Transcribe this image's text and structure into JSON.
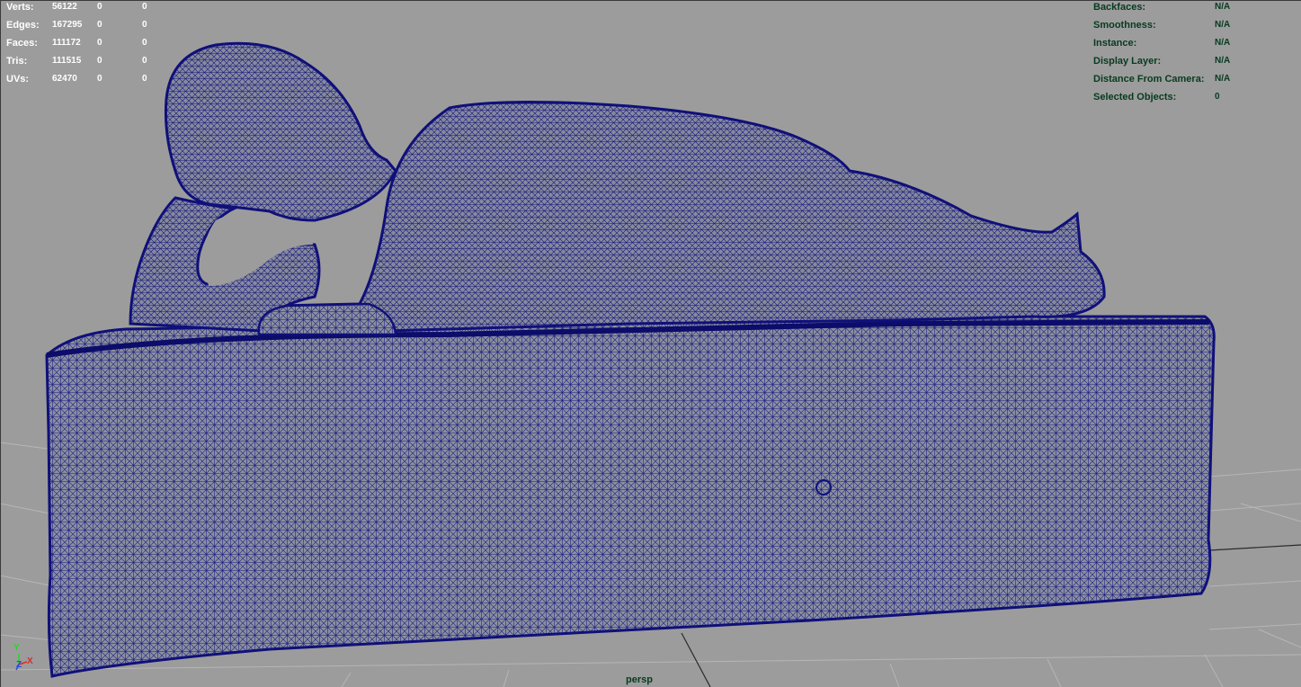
{
  "stats": {
    "rows": [
      {
        "label": "Verts:",
        "v1": "56122",
        "v2": "0",
        "v3": "0"
      },
      {
        "label": "Edges:",
        "v1": "167295",
        "v2": "0",
        "v3": "0"
      },
      {
        "label": "Faces:",
        "v1": "111172",
        "v2": "0",
        "v3": "0"
      },
      {
        "label": "Tris:",
        "v1": "111515",
        "v2": "0",
        "v3": "0"
      },
      {
        "label": "UVs:",
        "v1": "62470",
        "v2": "0",
        "v3": "0"
      }
    ]
  },
  "info": {
    "rows": [
      {
        "label": "Backfaces:",
        "value": "N/A"
      },
      {
        "label": "Smoothness:",
        "value": "N/A"
      },
      {
        "label": "Instance:",
        "value": "N/A"
      },
      {
        "label": "Display Layer:",
        "value": "N/A"
      },
      {
        "label": "Distance From Camera:",
        "value": "N/A"
      },
      {
        "label": "Selected Objects:",
        "value": "0"
      }
    ]
  },
  "camera": {
    "name": "persp"
  },
  "axes": {
    "y": "Y",
    "z": "Z",
    "x": "X"
  },
  "colors": {
    "background": "#9c9c9c",
    "grid": "#b4b4b4",
    "wire": "#10107a",
    "hud_stats": "#ffffff",
    "hud_info": "#083a20"
  },
  "icons": [
    "axis-gizmo-icon"
  ]
}
